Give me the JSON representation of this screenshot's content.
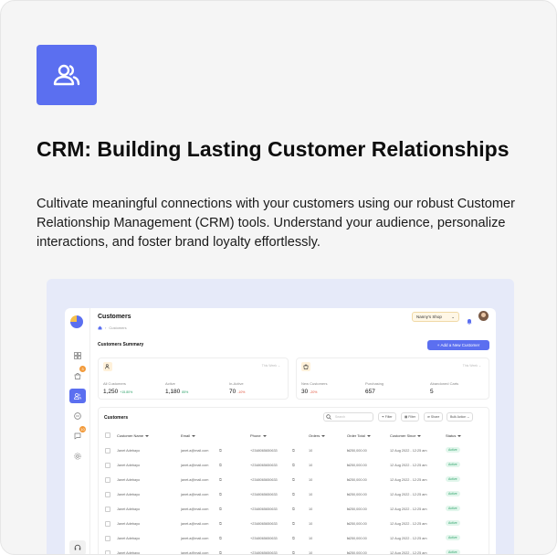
{
  "feature": {
    "title": "CRM: Building Lasting Customer Relationships",
    "description": "Cultivate meaningful connections with your customers using our robust Customer Relationship Management (CRM) tools. Understand your audience, personalize interactions, and foster brand loyalty effortlessly.",
    "icon": "users-icon"
  },
  "app": {
    "title": "Customers",
    "breadcrumb": "Customers",
    "shop_selector": "Nanny's Shop",
    "summary_title": "Customers Summary",
    "add_button": "Add a New Customer",
    "sidebar_badges": [
      "3",
      "10"
    ],
    "panels": [
      {
        "range": "This Week",
        "stats": [
          {
            "label": "All Customers",
            "value": "1,250",
            "change": "+15.80%",
            "trend": "up"
          },
          {
            "label": "Active",
            "value": "1,180",
            "change": "85%",
            "trend": "up"
          },
          {
            "label": "In-Active",
            "value": "70",
            "change": "-10%",
            "trend": "down"
          }
        ]
      },
      {
        "range": "This Week",
        "stats": [
          {
            "label": "New Customers",
            "value": "30",
            "change": "-20%",
            "trend": "down"
          },
          {
            "label": "Purchasing",
            "value": "657",
            "change": "",
            "trend": ""
          },
          {
            "label": "Abandoned Carts",
            "value": "5",
            "change": "",
            "trend": ""
          }
        ]
      }
    ],
    "table": {
      "title": "Customers",
      "search_placeholder": "Search",
      "buttons": [
        "Filter",
        "Filter",
        "Share",
        "Bulk Action"
      ],
      "columns": [
        "Customer Name",
        "Email",
        "Phone",
        "Orders",
        "Order Total",
        "Customer Since",
        "Status"
      ],
      "rows": [
        {
          "name": "Janet Adebayo",
          "email": "janet.a@mail.com",
          "phone": "+2348065650633",
          "orders": "10",
          "total": "₦250,000.00",
          "since": "12 Aug 2022 - 12:25 am",
          "status": "Active"
        },
        {
          "name": "Janet Adebayo",
          "email": "janet.a@mail.com",
          "phone": "+2348065650633",
          "orders": "10",
          "total": "₦250,000.00",
          "since": "12 Aug 2022 - 12:25 am",
          "status": "Active"
        },
        {
          "name": "Janet Adebayo",
          "email": "janet.a@mail.com",
          "phone": "+2348065650633",
          "orders": "10",
          "total": "₦250,000.00",
          "since": "12 Aug 2022 - 12:25 am",
          "status": "Active"
        },
        {
          "name": "Janet Adebayo",
          "email": "janet.a@mail.com",
          "phone": "+2348065650633",
          "orders": "10",
          "total": "₦250,000.00",
          "since": "12 Aug 2022 - 12:25 am",
          "status": "Active"
        },
        {
          "name": "Janet Adebayo",
          "email": "janet.a@mail.com",
          "phone": "+2348065650633",
          "orders": "10",
          "total": "₦250,000.00",
          "since": "12 Aug 2022 - 12:25 am",
          "status": "Active"
        },
        {
          "name": "Janet Adebayo",
          "email": "janet.a@mail.com",
          "phone": "+2348065650633",
          "orders": "10",
          "total": "₦250,000.00",
          "since": "12 Aug 2022 - 12:25 am",
          "status": "Active"
        },
        {
          "name": "Janet Adebayo",
          "email": "janet.a@mail.com",
          "phone": "+2348065650633",
          "orders": "10",
          "total": "₦250,000.00",
          "since": "12 Aug 2022 - 12:25 am",
          "status": "Active"
        },
        {
          "name": "Janet Adebayo",
          "email": "janet.a@mail.com",
          "phone": "+2348065650633",
          "orders": "10",
          "total": "₦250,000.00",
          "since": "12 Aug 2022 - 12:25 am",
          "status": "Active"
        }
      ]
    }
  },
  "colors": {
    "accent": "#5b6ff0",
    "active_status": "#2fa36b",
    "negative": "#e0523b",
    "preview_bg": "#e6eaf9"
  }
}
